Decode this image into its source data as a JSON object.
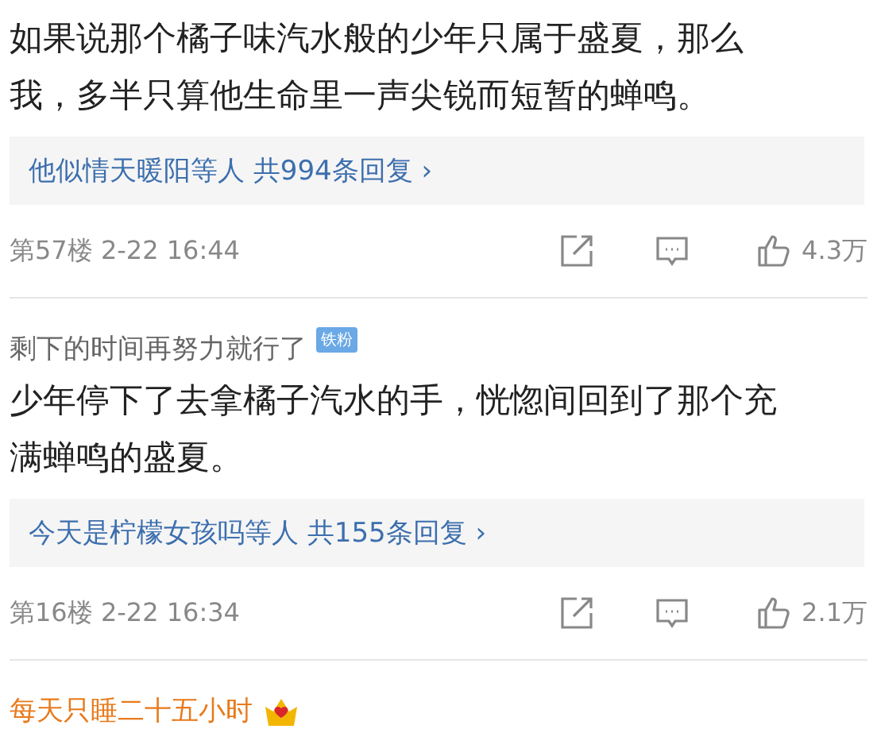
{
  "comments": [
    {
      "text": "如果说那个橘子味汽水般的少年只属于盛夏，那么我，多半只算他生命里一声尖锐而短暂的蝉鸣。",
      "replies": {
        "names": "他似情天暖阳等人",
        "count": "共994条回复",
        "arrow": "›"
      },
      "floor": "第57楼",
      "time": "2-22 16:44",
      "likes": "4.3万"
    },
    {
      "author": {
        "name": "剩下的时间再努力就行了",
        "vip": false,
        "badge": "铁粉"
      },
      "text": "少年停下了去拿橘子汽水的手，恍惚间回到了那个充满蝉鸣的盛夏。",
      "replies": {
        "names": "今天是柠檬女孩吗等人",
        "count": "共155条回复",
        "arrow": "›"
      },
      "floor": "第16楼",
      "time": "2-22 16:34",
      "likes": "2.1万"
    },
    {
      "author": {
        "name": "每天只睡二十五小时",
        "vip": true,
        "crown": true
      }
    }
  ]
}
